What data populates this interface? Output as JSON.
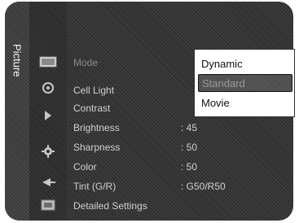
{
  "side_tab": {
    "label": "Picture"
  },
  "menu": {
    "items": [
      {
        "label": "Mode",
        "value": ""
      },
      {
        "label": "Cell Light",
        "value": ""
      },
      {
        "label": "Contrast",
        "value": ""
      },
      {
        "label": "Brightness",
        "value": ": 45"
      },
      {
        "label": "Sharpness",
        "value": ": 50"
      },
      {
        "label": "Color",
        "value": ": 50"
      },
      {
        "label": "Tint (G/R)",
        "value": ": G50/R50"
      },
      {
        "label": "Detailed Settings",
        "value": ""
      }
    ]
  },
  "mode_dropdown": {
    "options": [
      "Dynamic",
      "Standard",
      "Movie"
    ],
    "selected": "Standard"
  },
  "icons": [
    "picture-icon",
    "sound-icon",
    "channel-icon",
    "setup-icon",
    "input-icon",
    "application-icon"
  ]
}
